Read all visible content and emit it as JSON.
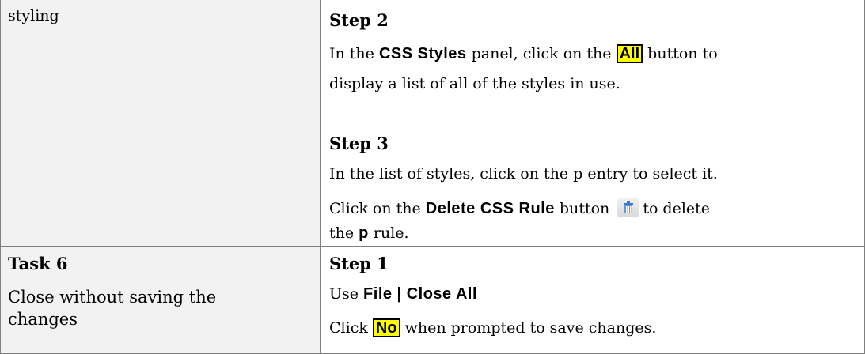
{
  "rows": {
    "r1_left": {
      "text": "styling"
    },
    "step2": {
      "heading": "Step 2",
      "line1_pre": "In the ",
      "line1_ui": "CSS Styles",
      "line1_mid": " panel, click on the ",
      "line1_button": "All",
      "line1_post": " button to",
      "line2": "display a list of all of the styles in use."
    },
    "step3": {
      "heading": "Step 3",
      "line1": "In the list of styles, click on the p entry to select it.",
      "line2_pre": "Click on the ",
      "line2_ui": "Delete CSS Rule",
      "line2_mid": " button",
      "line2_post": "to delete",
      "line3_pre": "the ",
      "line3_ui": "p",
      "line3_post": " rule.",
      "icon": "trash-can-icon"
    },
    "task6": {
      "heading": "Task 6",
      "line1": "Close without saving the",
      "line2": "changes"
    },
    "step1": {
      "heading": "Step 1",
      "line1_pre": "Use ",
      "line1_ui": "File | Close All",
      "line2_pre": "Click ",
      "line2_button": "No",
      "line2_post": " when prompted to save changes."
    }
  },
  "colors": {
    "border": "#7f7f7f",
    "left_cell_bg": "#f2f2f2",
    "highlight": "#ffff00",
    "icon_blue": "#3b78c9"
  }
}
